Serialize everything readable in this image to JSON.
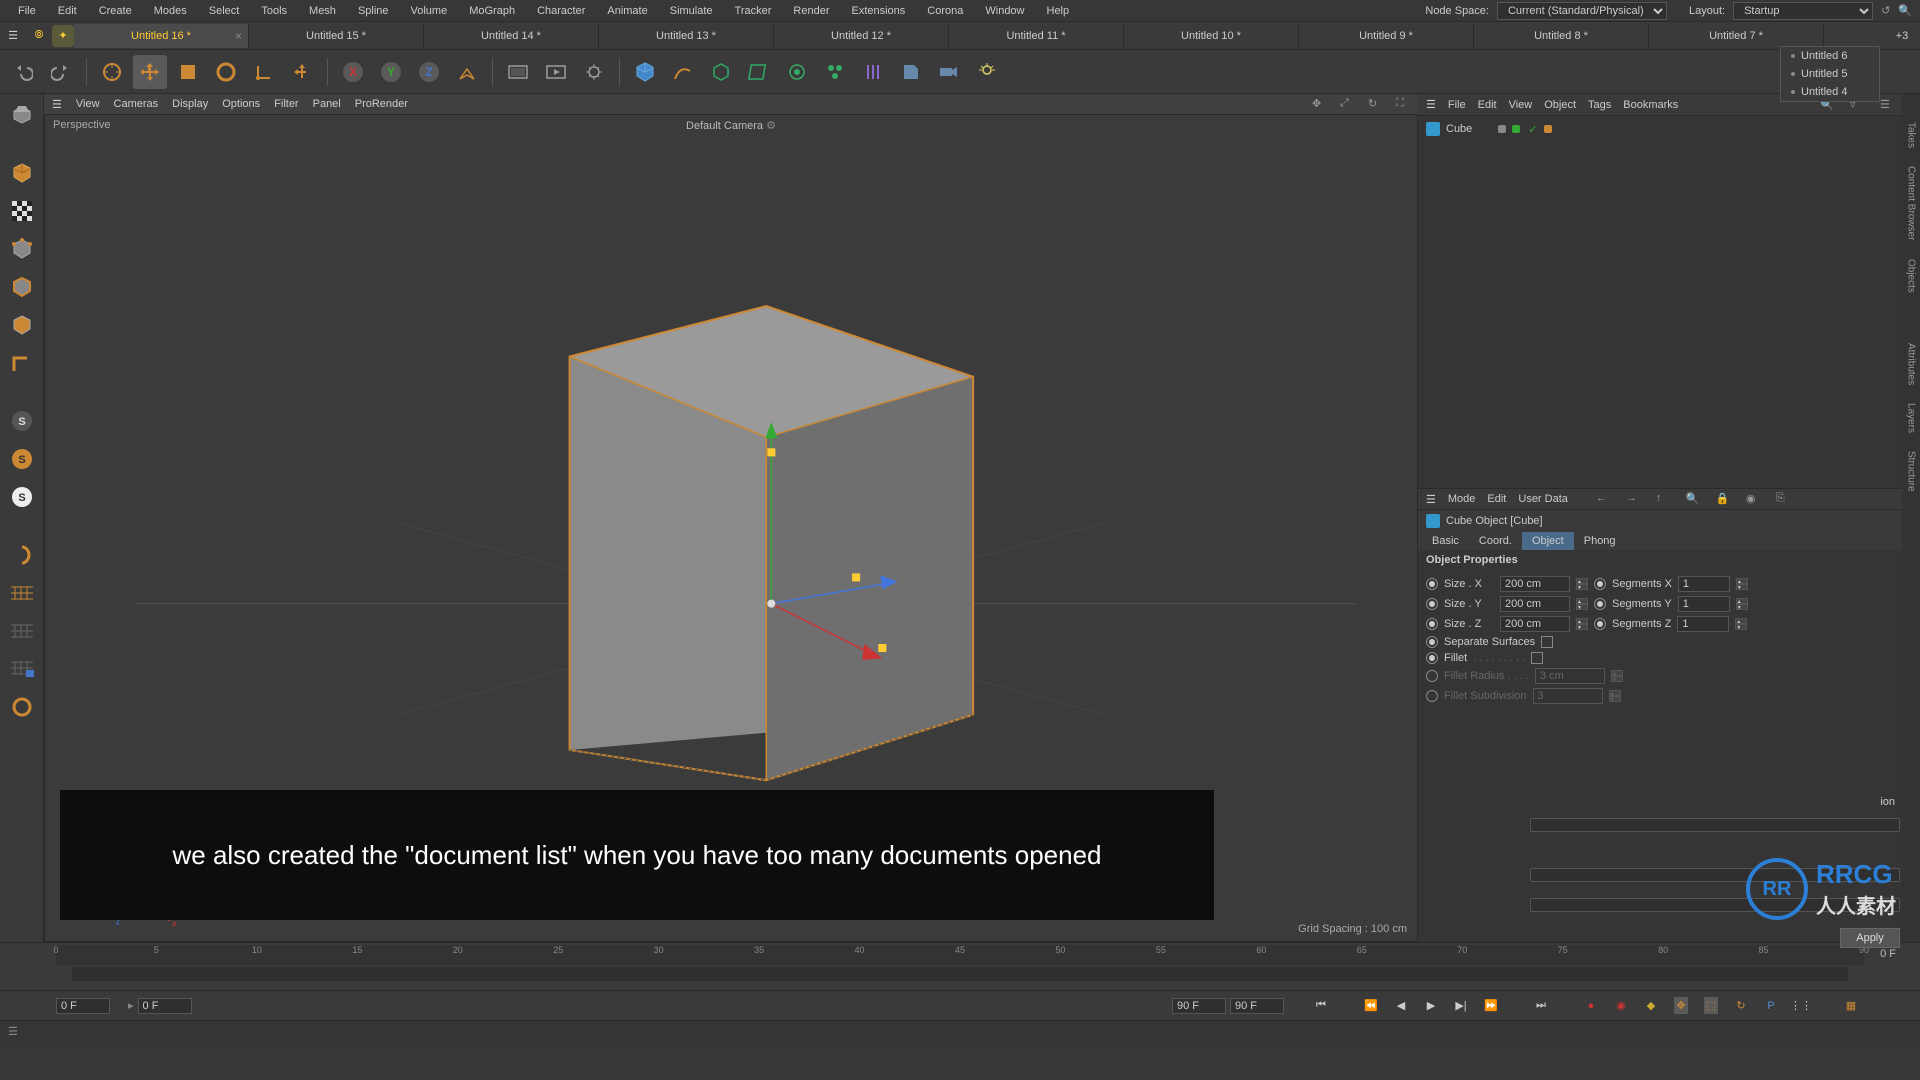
{
  "menubar": {
    "items": [
      "File",
      "Edit",
      "Create",
      "Modes",
      "Select",
      "Tools",
      "Mesh",
      "Spline",
      "Volume",
      "MoGraph",
      "Character",
      "Animate",
      "Simulate",
      "Tracker",
      "Render",
      "Extensions",
      "Corona",
      "Window",
      "Help"
    ],
    "node_space_label": "Node Space:",
    "node_space_value": "Current (Standard/Physical)",
    "layout_label": "Layout:",
    "layout_value": "Startup"
  },
  "tabs": {
    "items": [
      {
        "label": "Untitled 16 *",
        "active": true
      },
      {
        "label": "Untitled 15 *",
        "active": false
      },
      {
        "label": "Untitled 14 *",
        "active": false
      },
      {
        "label": "Untitled 13 *",
        "active": false
      },
      {
        "label": "Untitled 12 *",
        "active": false
      },
      {
        "label": "Untitled 11 *",
        "active": false
      },
      {
        "label": "Untitled 10 *",
        "active": false
      },
      {
        "label": "Untitled 9 *",
        "active": false
      },
      {
        "label": "Untitled 8 *",
        "active": false
      },
      {
        "label": "Untitled 7 *",
        "active": false
      }
    ],
    "more_label": "+3",
    "dropdown": [
      "Untitled 6",
      "Untitled 5",
      "Untitled 4"
    ]
  },
  "view_menu": [
    "View",
    "Cameras",
    "Display",
    "Options",
    "Filter",
    "Panel",
    "ProRender"
  ],
  "viewport": {
    "perspective": "Perspective",
    "camera": "Default Camera",
    "grid": "Grid Spacing : 100 cm"
  },
  "om": {
    "menu": [
      "File",
      "Edit",
      "View",
      "Object",
      "Tags",
      "Bookmarks"
    ],
    "obj_name": "Cube"
  },
  "attr": {
    "menu": [
      "Mode",
      "Edit",
      "User Data"
    ],
    "header": "Cube Object [Cube]",
    "tabs": {
      "basic": "Basic",
      "coord": "Coord.",
      "object": "Object",
      "phong": "Phong"
    },
    "section": "Object Properties",
    "size_x_label": "Size . X",
    "size_x": "200 cm",
    "seg_x_label": "Segments X",
    "seg_x": "1",
    "size_y_label": "Size . Y",
    "size_y": "200 cm",
    "seg_y_label": "Segments Y",
    "seg_y": "1",
    "size_z_label": "Size . Z",
    "size_z": "200 cm",
    "seg_z_label": "Segments Z",
    "seg_z": "1",
    "sep_surf": "Separate Surfaces",
    "fillet": "Fillet",
    "fillet_rad_label": "Fillet Radius . . . .",
    "fillet_rad": "3 cm",
    "fillet_sub_label": "Fillet Subdivision",
    "fillet_sub": "3"
  },
  "timeline": {
    "ticks": [
      "0",
      "5",
      "10",
      "15",
      "20",
      "25",
      "30",
      "35",
      "40",
      "45",
      "50",
      "55",
      "60",
      "65",
      "70",
      "75",
      "80",
      "85",
      "90"
    ],
    "start": "0 F",
    "cur": "0 F",
    "end1": "90 F",
    "end2": "90 F",
    "right": "0 F"
  },
  "right_tabs": [
    "Takes",
    "Content Browser",
    "Objects",
    "Attributes",
    "Layers",
    "Structure"
  ],
  "subtitle": "we also created the \"document list\" when you have too many documents opened",
  "apply": "Apply",
  "watermark": {
    "initials": "RR",
    "big": "RRCG",
    "small": "人人素材"
  }
}
